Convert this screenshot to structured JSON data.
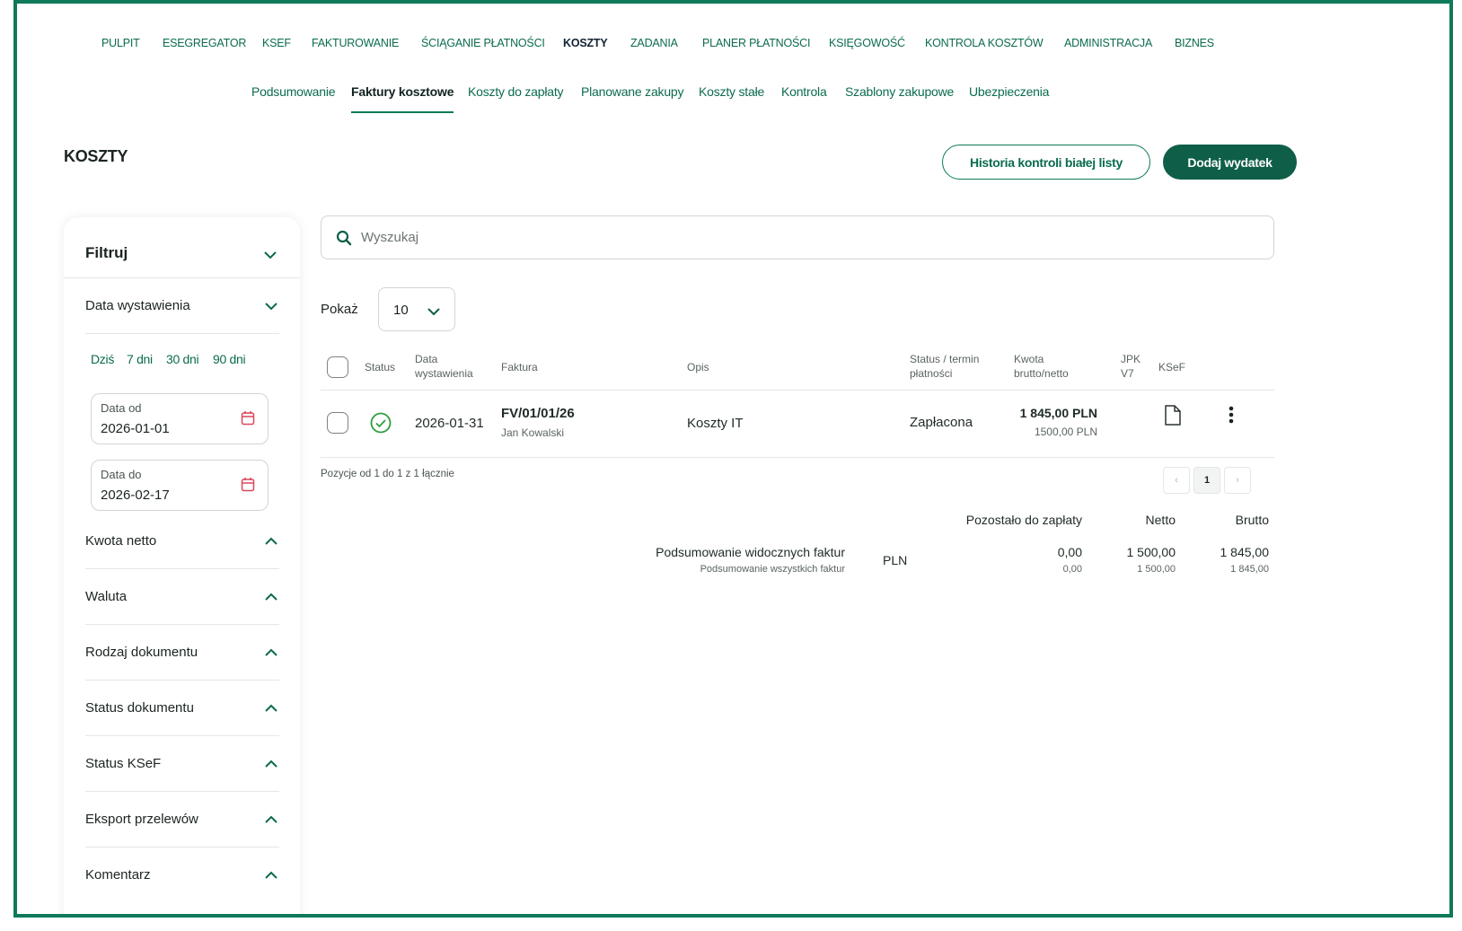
{
  "topnav": [
    "PULPIT",
    "ESEGREGATOR",
    "KSEF",
    "FAKTUROWANIE",
    "ŚCIĄGANIE PŁATNOŚCI",
    "KOSZTY",
    "ZADANIA",
    "PLANER PŁATNOŚCI",
    "KSIĘGOWOŚĆ",
    "KONTROLA KOSZTÓW",
    "ADMINISTRACJA",
    "BIZNES"
  ],
  "subnav": [
    "Podsumowanie",
    "Faktury kosztowe",
    "Koszty do zapłaty",
    "Planowane zakupy",
    "Koszty stałe",
    "Kontrola",
    "Szablony zakupowe",
    "Ubezpieczenia"
  ],
  "page_title": "KOSZTY",
  "buttons": {
    "history": "Historia kontroli białej listy",
    "add": "Dodaj wydatek"
  },
  "filter": {
    "title": "Filtruj",
    "date_section": "Data wystawienia",
    "quick": [
      "Dziś",
      "7 dni",
      "30 dni",
      "90 dni"
    ],
    "date_from_label": "Data od",
    "date_from": "2026-01-01",
    "date_to_label": "Data do",
    "date_to": "2026-02-17",
    "sections": [
      "Kwota netto",
      "Waluta",
      "Rodzaj dokumentu",
      "Status dokumentu",
      "Status KSeF",
      "Eksport przelewów",
      "Komentarz"
    ]
  },
  "search": {
    "placeholder": "Wyszukaj"
  },
  "show": {
    "label": "Pokaż",
    "value": "10"
  },
  "table": {
    "headers": {
      "status": "Status",
      "date1": "Data",
      "date2": "wystawienia",
      "invoice": "Faktura",
      "desc": "Opis",
      "pay1": "Status / termin",
      "pay2": "płatności",
      "amount1": "Kwota",
      "amount2": "brutto/netto",
      "jpk1": "JPK",
      "jpk2": "V7",
      "ksef": "KSeF"
    },
    "rows": [
      {
        "date": "2026-01-31",
        "invoice": "FV/01/01/26",
        "contractor": "Jan Kowalski",
        "desc": "Koszty IT",
        "pay_status": "Zapłacona",
        "gross": "1 845,00 PLN",
        "net": "1500,00 PLN"
      }
    ]
  },
  "pager": {
    "text": "Pozycje od 1 do 1 z 1 łącznie",
    "prev": "‹",
    "page": "1",
    "next": "›"
  },
  "summary": {
    "headers": {
      "remaining": "Pozostało do zapłaty",
      "net": "Netto",
      "gross": "Brutto"
    },
    "visible_label": "Podsumowanie widocznych faktur",
    "all_label": "Podsumowanie wszystkich faktur",
    "currency": "PLN",
    "visible": {
      "remaining": "0,00",
      "net": "1 500,00",
      "gross": "1 845,00"
    },
    "all": {
      "remaining": "0,00",
      "net": "1 500,00",
      "gross": "1 845,00"
    }
  },
  "colors": {
    "brand": "#0e7a5a",
    "brand_dark": "#0e5e48",
    "success": "#2e9e3e"
  }
}
